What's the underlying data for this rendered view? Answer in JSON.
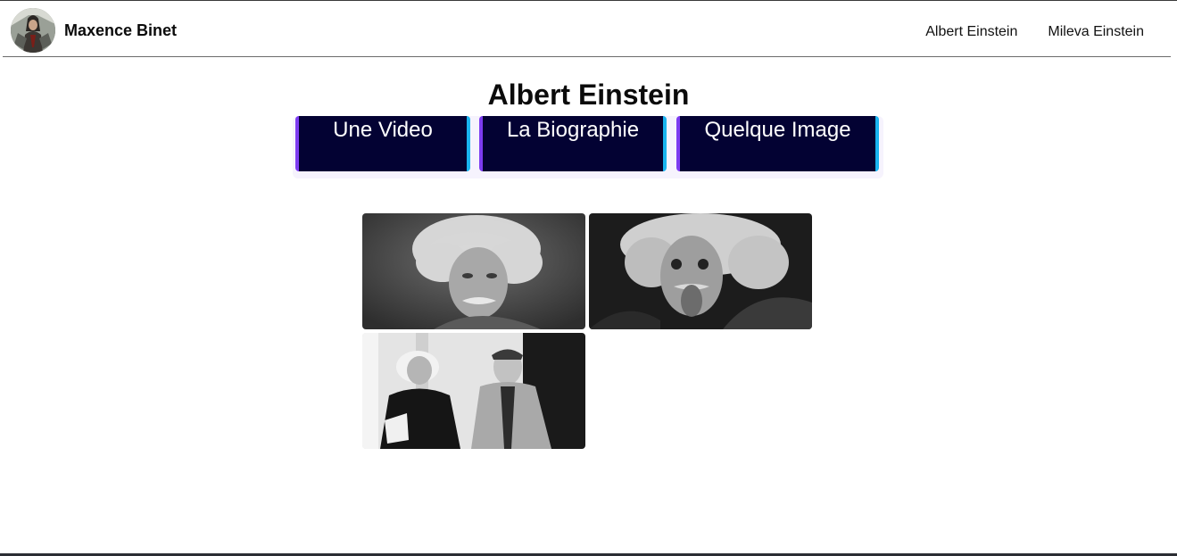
{
  "header": {
    "brand_name": "Maxence Binet",
    "avatar_icon": "profile-avatar",
    "nav_links": [
      {
        "label": "Albert Einstein"
      },
      {
        "label": "Mileva Einstein"
      }
    ]
  },
  "main": {
    "title": "Albert Einstein",
    "tabs": [
      {
        "label": "Une Video"
      },
      {
        "label": "La Biographie"
      },
      {
        "label": "Quelque Image"
      }
    ],
    "gallery": {
      "images": [
        {
          "subject": "einstein-portrait"
        },
        {
          "subject": "einstein-tongue-out"
        },
        {
          "subject": "einstein-with-colleague"
        }
      ]
    }
  },
  "colors": {
    "tab_background": "#030233",
    "tab_border_left": "#7d3cf1",
    "tab_border_right": "#19b4f0",
    "tab_bar_background": "#f6f3fd",
    "text": "#111111"
  }
}
